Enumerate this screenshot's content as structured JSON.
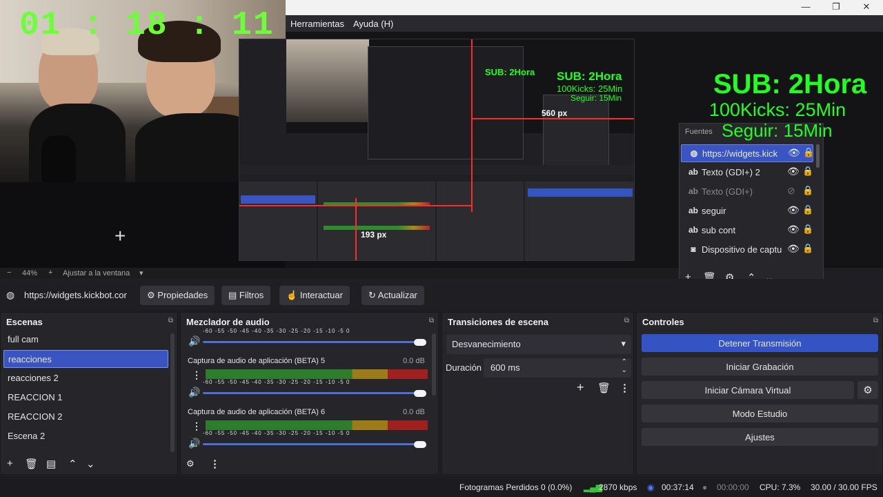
{
  "window": {
    "minimize": "—",
    "maximize": "❐",
    "close": "✕"
  },
  "menu": {
    "tools": "Herramientas",
    "help": "Ayuda (H)"
  },
  "preview": {
    "timer": "01 : 18 : 11",
    "overlay_sub": "SUB: 2Hora",
    "overlay_kicks": "100Kicks: 25Min",
    "overlay_follow": "Seguir: 15Min",
    "px_label_1": "560 px",
    "px_label_2": "193 px"
  },
  "sources": {
    "title": "Fuentes",
    "items": [
      {
        "icon": "globe",
        "label": "https://widgets.kick",
        "visible": true,
        "selected": true
      },
      {
        "icon": "text",
        "label": "Texto (GDI+) 2",
        "visible": true
      },
      {
        "icon": "text",
        "label": "Texto (GDI+)",
        "visible": false
      },
      {
        "icon": "text",
        "label": "seguir",
        "visible": true
      },
      {
        "icon": "text",
        "label": "sub cont",
        "visible": true
      },
      {
        "icon": "camera",
        "label": "Dispositivo de captu",
        "visible": true
      }
    ]
  },
  "zoom": {
    "level": "44%",
    "fit": "Ajustar a la ventana"
  },
  "source_toolbar": {
    "url": "https://widgets.kickbot.cor",
    "properties": "Propiedades",
    "filters": "Filtros",
    "interact": "Interactuar",
    "refresh": "Actualizar"
  },
  "scenes": {
    "title": "Escenas",
    "items": [
      "full cam",
      "reacciones",
      "reacciones 2",
      "REACCION 1",
      "REACCION  2",
      "Escena 2"
    ],
    "selected": "reacciones"
  },
  "mixer": {
    "title": "Mezclador de audio",
    "ticks": "-60 -55 -50 -45 -40 -35 -30 -25 -20 -15 -10 -5 0",
    "channels": [
      {
        "name": "Captura de audio de aplicación (BETA) 5",
        "db": "0.0 dB"
      },
      {
        "name": "Captura de audio de aplicación (BETA) 6",
        "db": "0.0 dB"
      }
    ]
  },
  "transitions": {
    "title": "Transiciones de escena",
    "type": "Desvanecimiento",
    "duration_label": "Duración",
    "duration_value": "600 ms"
  },
  "controls": {
    "title": "Controles",
    "stop_stream": "Detener Transmisión",
    "start_recording": "Iniciar Grabación",
    "virtual_cam": "Iniciar Cámara Virtual",
    "studio_mode": "Modo Estudio",
    "settings": "Ajustes"
  },
  "status": {
    "dropped_frames": "Fotogramas Perdidos 0 (0.0%)",
    "bitrate": "2870 kbps",
    "stream_time": "00:37:14",
    "record_time": "00:00:00",
    "cpu": "CPU: 7.3%",
    "fps": "30.00 / 30.00 FPS"
  },
  "colors": {
    "accent": "#3454c4",
    "overlay_green": "#22ff22",
    "timer_green": "#6cff3a",
    "guide_red": "#ff2a2a"
  }
}
